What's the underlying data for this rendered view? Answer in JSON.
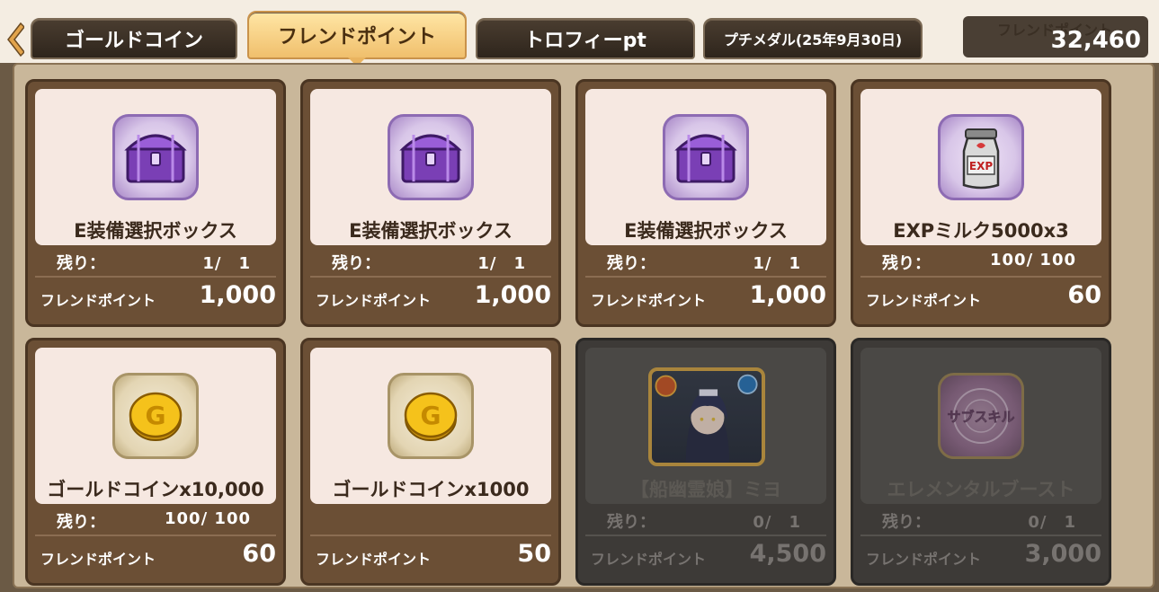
{
  "tabs": [
    {
      "label": "ゴールドコイン",
      "active": false
    },
    {
      "label": "フレンドポイント",
      "active": true
    },
    {
      "label": "トロフィーpt",
      "active": false
    },
    {
      "label": "プチメダル(25年9月30日)",
      "active": false
    }
  ],
  "balance": {
    "label": "フレンドポイント",
    "value": "32,460"
  },
  "items": [
    {
      "name": "E装備選択ボックス",
      "stock_label": "残り：",
      "stock": "1/　1",
      "price_label": "フレンドポイント",
      "price": "1,000",
      "icon": "treasure-chest-icon",
      "soldout": false
    },
    {
      "name": "E装備選択ボックス",
      "stock_label": "残り：",
      "stock": "1/　1",
      "price_label": "フレンドポイント",
      "price": "1,000",
      "icon": "treasure-chest-icon",
      "soldout": false
    },
    {
      "name": "E装備選択ボックス",
      "stock_label": "残り：",
      "stock": "1/　1",
      "price_label": "フレンドポイント",
      "price": "1,000",
      "icon": "treasure-chest-icon",
      "soldout": false
    },
    {
      "name": "EXPミルク5000x3",
      "stock_label": "残り：",
      "stock": "100/ 100",
      "price_label": "フレンドポイント",
      "price": "60",
      "icon": "exp-milk-can-icon",
      "soldout": false
    },
    {
      "name": "ゴールドコインx10,000",
      "stock_label": "残り：",
      "stock": "100/ 100",
      "price_label": "フレンドポイント",
      "price": "60",
      "icon": "gold-coin-icon",
      "soldout": false
    },
    {
      "name": "ゴールドコインx1000",
      "stock_label": "",
      "stock": "",
      "price_label": "フレンドポイント",
      "price": "50",
      "icon": "gold-coin-icon",
      "soldout": false
    },
    {
      "name": "【船幽霊娘】ミヨ",
      "stock_label": "残り：",
      "stock": "0/　1",
      "price_label": "フレンドポイント",
      "price": "4,500",
      "icon": "character-portrait-icon",
      "soldout": true
    },
    {
      "name": "エレメンタルブースト",
      "stock_label": "残り：",
      "stock": "0/　1",
      "price_label": "フレンドポイント",
      "price": "3,000",
      "icon": "sub-skill-icon",
      "icon_text": "サブスキル",
      "soldout": true
    }
  ],
  "colors": {
    "active_tab": "#f0bf6c",
    "card_frame": "#6b4f35",
    "panel": "#c9b79a"
  }
}
